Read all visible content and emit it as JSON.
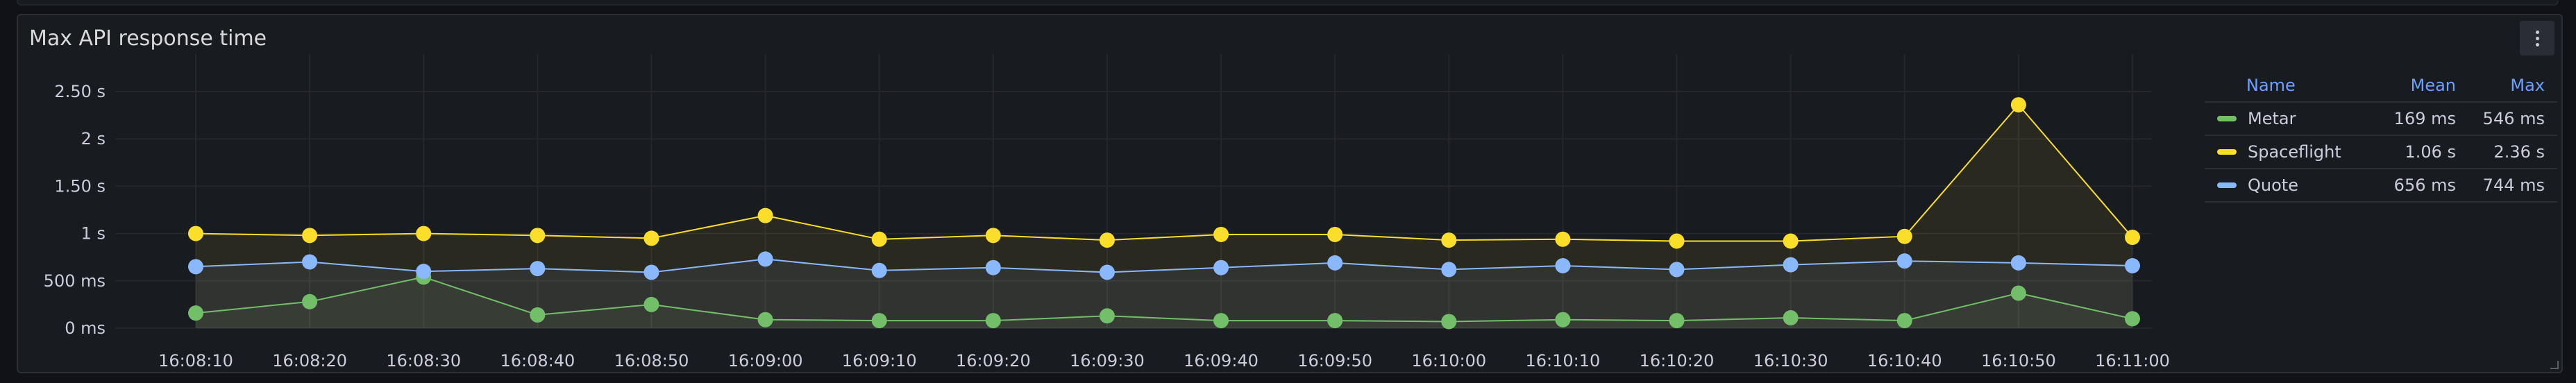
{
  "panel": {
    "title": "Max API response time",
    "menu_icon": "kebab-menu-icon"
  },
  "chart_data": {
    "type": "line",
    "title": "Max API response time",
    "x": [
      "16:08:10",
      "16:08:20",
      "16:08:30",
      "16:08:40",
      "16:08:50",
      "16:09:00",
      "16:09:10",
      "16:09:20",
      "16:09:30",
      "16:09:40",
      "16:09:50",
      "16:10:00",
      "16:10:10",
      "16:10:20",
      "16:10:30",
      "16:10:40",
      "16:10:50",
      "16:11:00"
    ],
    "y_ticks": [
      "0 ms",
      "500 ms",
      "1 s",
      "1.50 s",
      "2 s",
      "2.50 s"
    ],
    "ylim": [
      0,
      2.5
    ],
    "y_unit": "s",
    "grid": true,
    "legend": "right",
    "series": [
      {
        "name": "Metar",
        "color": "#73bf69",
        "values": [
          0.16,
          0.28,
          0.54,
          0.14,
          0.25,
          0.09,
          0.08,
          0.08,
          0.13,
          0.08,
          0.08,
          0.07,
          0.09,
          0.08,
          0.11,
          0.08,
          0.37,
          0.1
        ]
      },
      {
        "name": "Spaceflight",
        "color": "#fade2a",
        "values": [
          1.0,
          0.98,
          1.0,
          0.98,
          0.95,
          1.19,
          0.94,
          0.98,
          0.93,
          0.99,
          0.99,
          0.93,
          0.94,
          0.92,
          0.92,
          0.97,
          2.36,
          0.96
        ]
      },
      {
        "name": "Quote",
        "color": "#8ab8ff",
        "values": [
          0.65,
          0.7,
          0.6,
          0.63,
          0.59,
          0.73,
          0.61,
          0.64,
          0.59,
          0.64,
          0.69,
          0.62,
          0.66,
          0.62,
          0.67,
          0.71,
          0.69,
          0.66
        ]
      }
    ]
  },
  "legend": {
    "headers": {
      "name": "Name",
      "mean": "Mean",
      "max": "Max"
    },
    "rows": [
      {
        "name": "Metar",
        "color": "#73bf69",
        "mean": "169 ms",
        "max": "546 ms"
      },
      {
        "name": "Spaceflight",
        "color": "#fade2a",
        "mean": "1.06 s",
        "max": "2.36 s"
      },
      {
        "name": "Quote",
        "color": "#8ab8ff",
        "mean": "656 ms",
        "max": "744 ms"
      }
    ]
  }
}
